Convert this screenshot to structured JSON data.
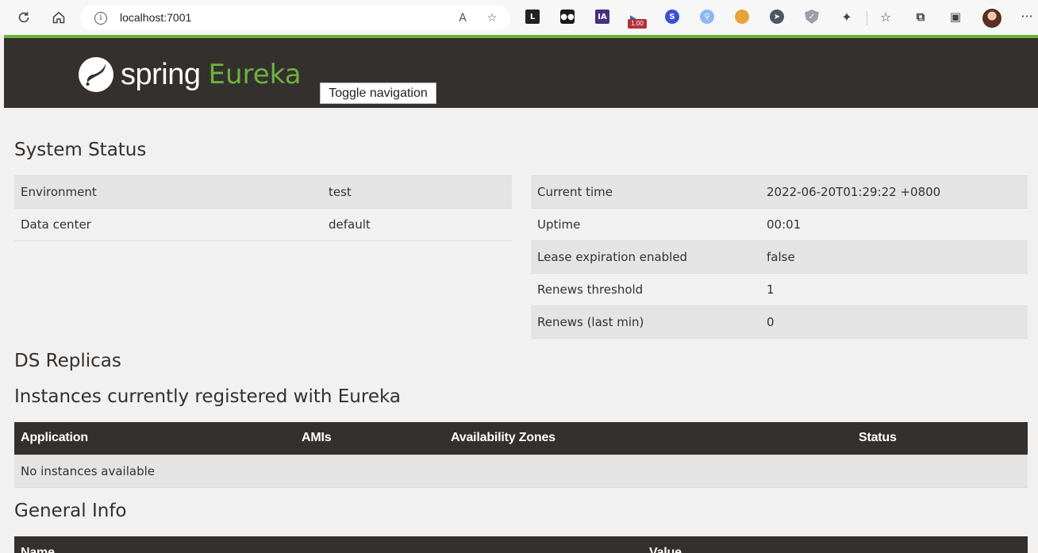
{
  "browser": {
    "url": "localhost:7001"
  },
  "header": {
    "brand_spring": "spring",
    "brand_eureka": "Eureka",
    "toggle_label": "Toggle navigation",
    "accent_color": "#6db33f",
    "bar_color": "#34302d"
  },
  "system_status": {
    "title": "System Status",
    "left": [
      {
        "key": "Environment",
        "value": "test"
      },
      {
        "key": "Data center",
        "value": "default"
      }
    ],
    "right": [
      {
        "key": "Current time",
        "value": "2022-06-20T01:29:22 +0800"
      },
      {
        "key": "Uptime",
        "value": "00:01"
      },
      {
        "key": "Lease expiration enabled",
        "value": "false"
      },
      {
        "key": "Renews threshold",
        "value": "1"
      },
      {
        "key": "Renews (last min)",
        "value": "0"
      }
    ]
  },
  "ds_replicas": {
    "title": "DS Replicas"
  },
  "instances": {
    "title": "Instances currently registered with Eureka",
    "columns": [
      "Application",
      "AMIs",
      "Availability Zones",
      "Status"
    ],
    "empty_message": "No instances available"
  },
  "general_info": {
    "title": "General Info",
    "columns": [
      "Name",
      "Value"
    ]
  }
}
